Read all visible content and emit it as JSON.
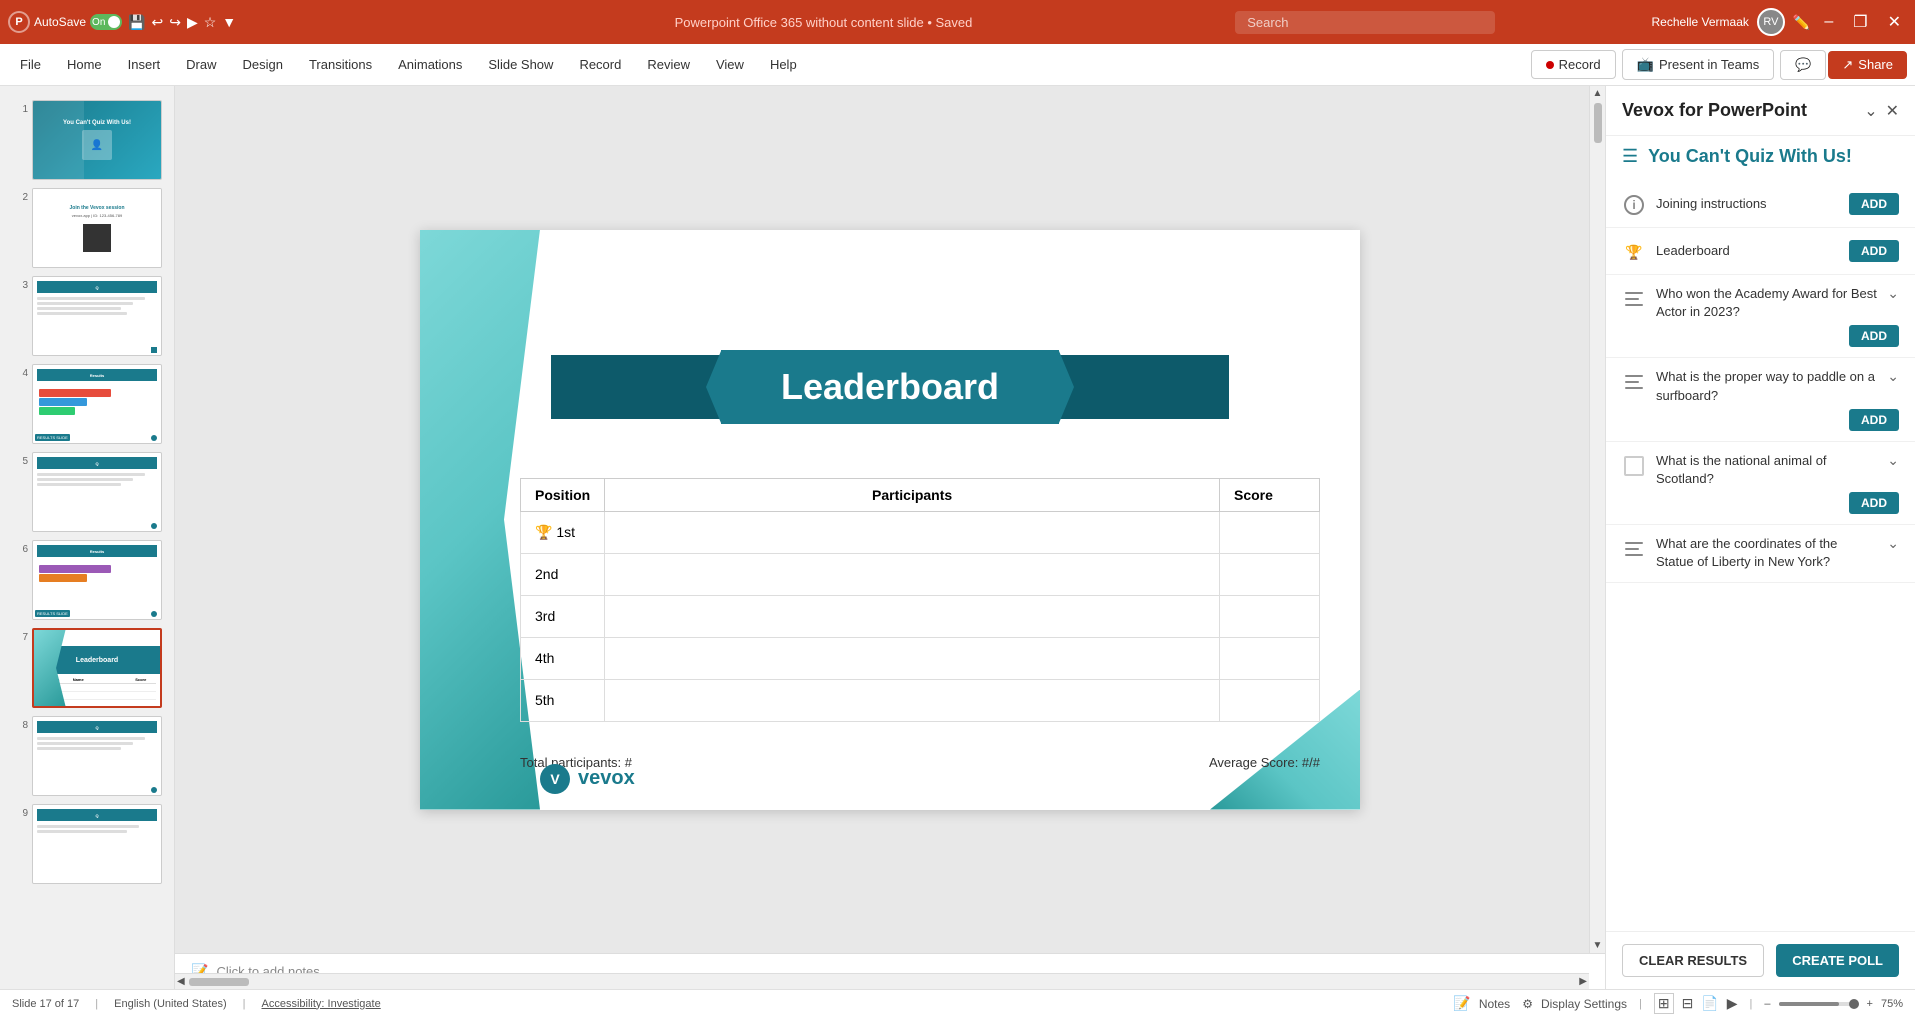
{
  "titlebar": {
    "autosave_label": "AutoSave",
    "toggle_state": "On",
    "title": "Powerpoint Office 365 without content slide • Saved",
    "search_placeholder": "Search",
    "user_name": "Rechelle Vermaak",
    "minimize": "–",
    "restore": "❐",
    "close": "✕"
  },
  "menubar": {
    "items": [
      "File",
      "Home",
      "Insert",
      "Draw",
      "Design",
      "Transitions",
      "Animations",
      "Slide Show",
      "Record",
      "Review",
      "View",
      "Help"
    ],
    "record_label": "Record",
    "present_label": "Present in Teams",
    "share_label": "Share"
  },
  "slidepanel": {
    "slide_count": "Slide 17 of 17",
    "slides": [
      {
        "num": "1",
        "type": "title"
      },
      {
        "num": "2",
        "type": "qr"
      },
      {
        "num": "3",
        "type": "question"
      },
      {
        "num": "4",
        "type": "results"
      },
      {
        "num": "5",
        "type": "question2"
      },
      {
        "num": "6",
        "type": "results2"
      },
      {
        "num": "7",
        "type": "leaderboard"
      },
      {
        "num": "8",
        "type": "question3"
      },
      {
        "num": "9",
        "type": "question4"
      }
    ]
  },
  "slide": {
    "title": "Leaderboard",
    "table": {
      "headers": [
        "Position",
        "Participants",
        "Score"
      ],
      "rows": [
        {
          "pos": "1st",
          "participants": "",
          "score": "",
          "trophy": "🏆"
        },
        {
          "pos": "2nd",
          "participants": "",
          "score": ""
        },
        {
          "pos": "3rd",
          "participants": "",
          "score": ""
        },
        {
          "pos": "4th",
          "participants": "",
          "score": ""
        },
        {
          "pos": "5th",
          "participants": "",
          "score": ""
        }
      ]
    },
    "footer_left": "Total participants: #",
    "footer_right": "Average Score: #/#",
    "logo_text": "vevox"
  },
  "notes": {
    "placeholder": "Click to add notes",
    "label": "Notes"
  },
  "statusbar": {
    "slide_info": "Slide 17 of 17",
    "language": "English (United States)",
    "accessibility": "Accessibility: Investigate",
    "zoom": "75%"
  },
  "vevox_panel": {
    "title": "Vevox for PowerPoint",
    "nav_title": "You Can't Quiz With Us!",
    "items": [
      {
        "id": "joining",
        "icon": "info",
        "label": "Joining instructions",
        "has_add": true,
        "has_expand": false
      },
      {
        "id": "leaderboard",
        "icon": "trophy",
        "label": "Leaderboard",
        "has_add": true,
        "has_expand": false
      },
      {
        "id": "question1",
        "icon": "bars",
        "label": "Who won the Academy Award for Best Actor in 2023?",
        "has_add": true,
        "has_expand": true
      },
      {
        "id": "question2",
        "icon": "bars",
        "label": "What is the proper way to paddle on a surfboard?",
        "has_add": true,
        "has_expand": true
      },
      {
        "id": "question3",
        "icon": "checkbox",
        "label": "What is the national animal of Scotland?",
        "has_add": true,
        "has_expand": true
      },
      {
        "id": "question4",
        "icon": "bars",
        "label": "What are the coordinates of the Statue of Liberty in New York?",
        "has_add": false,
        "has_expand": true
      }
    ],
    "footer": {
      "clear_label": "CLEAR RESULTS",
      "create_label": "CREATE POLL"
    },
    "add_label": "ADD"
  }
}
